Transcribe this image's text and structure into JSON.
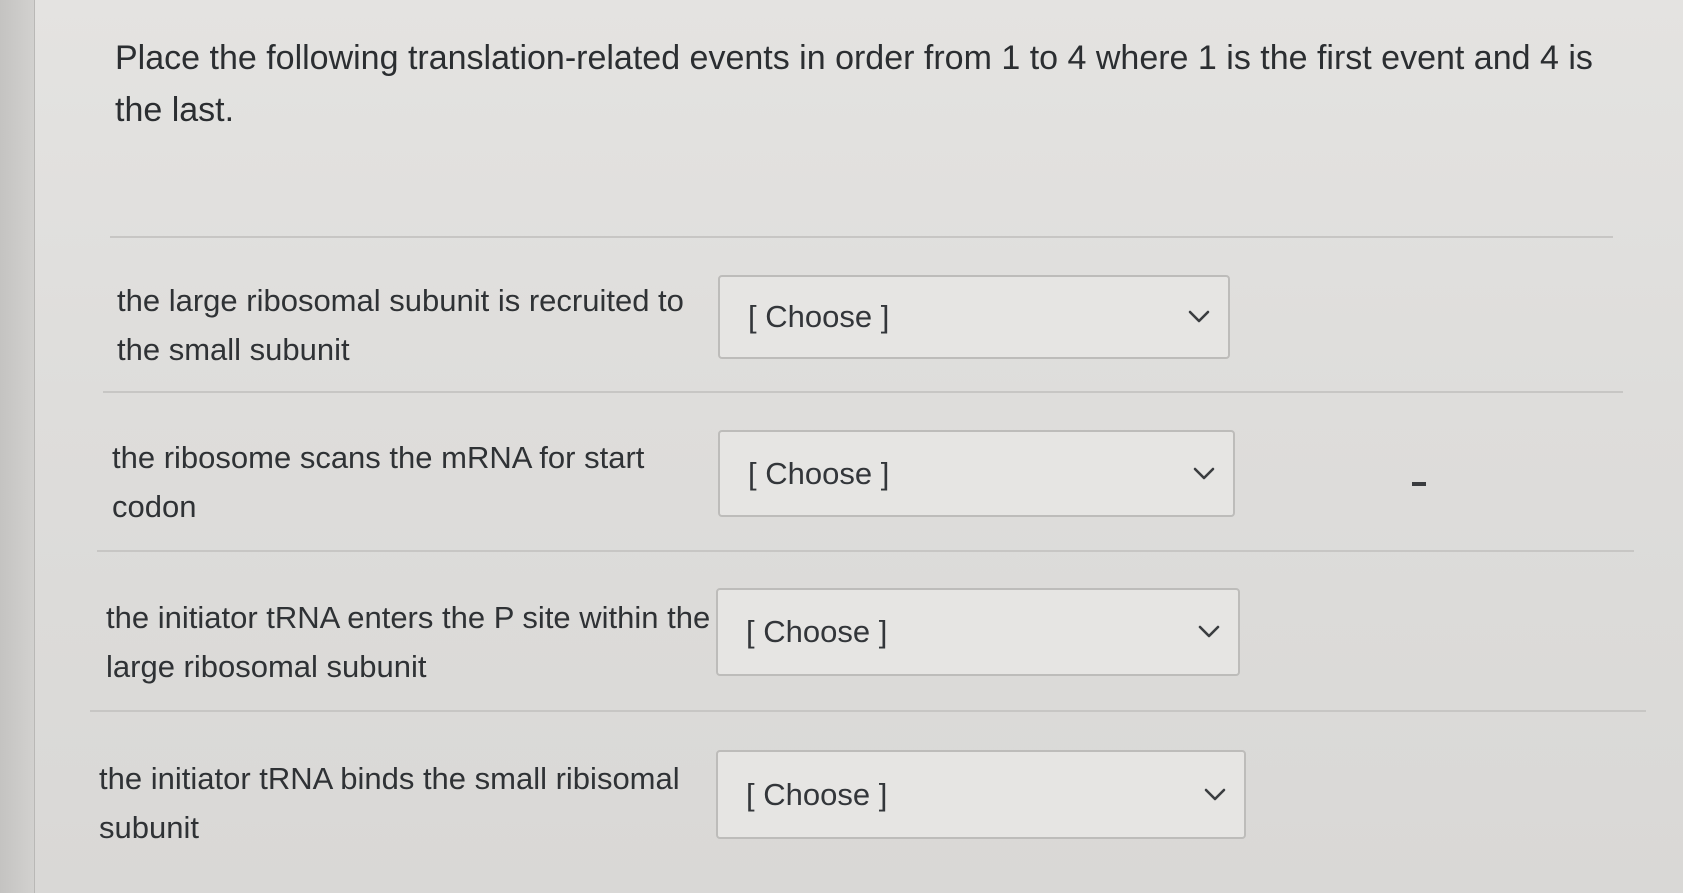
{
  "question": {
    "prompt": "Place the following translation-related events in order from 1 to 4 where 1 is the first event and 4 is the last."
  },
  "events": [
    {
      "label": "the large ribosomal subunit is recruited to the small subunit",
      "selected": "[ Choose ]"
    },
    {
      "label": "the ribosome scans the mRNA for start codon",
      "selected": "[ Choose ]"
    },
    {
      "label": "the initiator tRNA enters the P site within the large ribosomal subunit",
      "selected": "[ Choose ]"
    },
    {
      "label": "the initiator tRNA binds the small ribisomal subunit",
      "selected": "[ Choose ]"
    }
  ],
  "icons": {
    "dropdown": "chevron-down-icon"
  }
}
